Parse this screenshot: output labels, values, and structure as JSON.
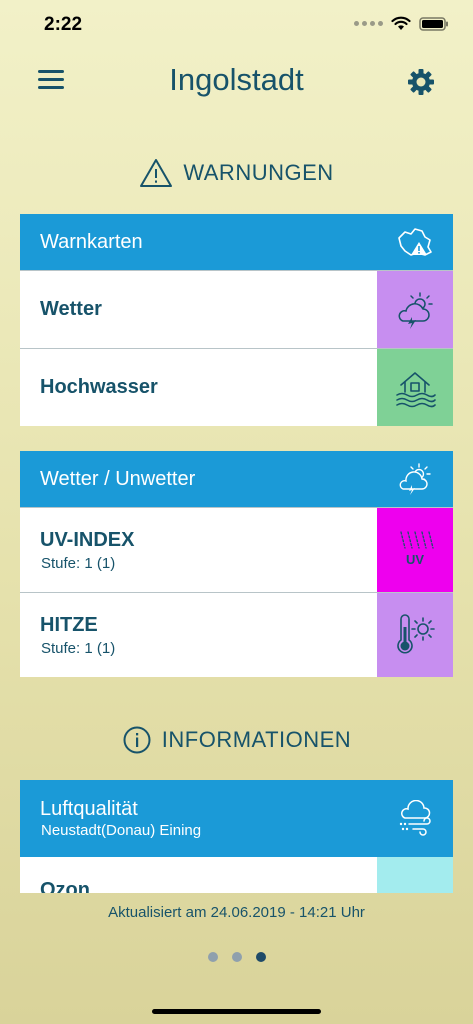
{
  "status_bar": {
    "time": "2:22"
  },
  "header": {
    "title": "Ingolstadt"
  },
  "warnings_section": {
    "heading": "WARNUNGEN",
    "cards": [
      {
        "title": "Warnkarten",
        "icon": "bavaria-warning-icon",
        "rows": [
          {
            "title": "Wetter",
            "icon": "storm-cloud-icon",
            "tile_color": "#c78ef0"
          },
          {
            "title": "Hochwasser",
            "icon": "flood-house-icon",
            "tile_color": "#7fd196"
          }
        ]
      },
      {
        "title": "Wetter / Unwetter",
        "icon": "weather-icon",
        "rows": [
          {
            "title": "UV-INDEX",
            "subtitle": "Stufe: 1 (1)",
            "icon": "uv-icon",
            "icon_text": "UV",
            "tile_color": "#ee00ee"
          },
          {
            "title": "HITZE",
            "subtitle": "Stufe: 1 (1)",
            "icon": "thermometer-sun-icon",
            "tile_color": "#c78ef0"
          }
        ]
      }
    ]
  },
  "info_section": {
    "heading": "INFORMATIONEN",
    "card": {
      "title": "Luftqualität",
      "subtitle": "Neustadt(Donau) Eining",
      "icon": "air-quality-icon",
      "rows": [
        {
          "title": "Ozon",
          "tile_color": "#a3ecee"
        }
      ]
    }
  },
  "footer": {
    "updated": "Aktualisiert am 24.06.2019 - 14:21 Uhr"
  },
  "pagination": {
    "pages": 3,
    "current": 3
  },
  "colors": {
    "primary": "#17536a",
    "card_header": "#1b9ad7"
  }
}
